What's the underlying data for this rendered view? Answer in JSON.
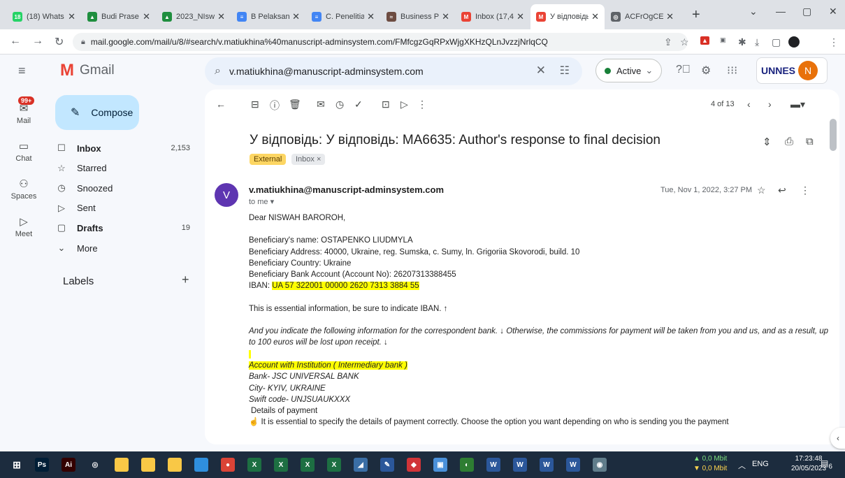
{
  "browser": {
    "tabs": [
      {
        "title": "(18) Whats",
        "fav_color": "#25d366",
        "fav_text": "18"
      },
      {
        "title": "Budi Prase",
        "fav_color": "#1e8e3e",
        "fav_text": "▲"
      },
      {
        "title": "2023_NIsw",
        "fav_color": "#1e8e3e",
        "fav_text": "▲"
      },
      {
        "title": "B Pelaksan",
        "fav_color": "#4285f4",
        "fav_text": "≡"
      },
      {
        "title": "C. Penelitia",
        "fav_color": "#4285f4",
        "fav_text": "≡"
      },
      {
        "title": "Business P",
        "fav_color": "#6d4c41",
        "fav_text": "≈"
      },
      {
        "title": "Inbox (17,4",
        "fav_color": "#ea4335",
        "fav_text": "M"
      },
      {
        "title": "У відповідь",
        "fav_color": "#ea4335",
        "fav_text": "M"
      },
      {
        "title": "ACFrOgCE",
        "fav_color": "#5f6368",
        "fav_text": "◎"
      }
    ],
    "url": "mail.google.com/mail/u/8/#search/v.matiukhina%40manuscript-adminsystem.com/FMfcgzGqRPxWjgXKHzQLnJvzzjNrlqCQ"
  },
  "gmail": {
    "wordmark": "Gmail",
    "search_query": "v.matiukhina@manuscript-adminsystem.com",
    "status": "Active",
    "org_logo": "UNNES",
    "avatar_letter": "N"
  },
  "rail": {
    "mail_badge": "99+",
    "items": [
      "Mail",
      "Chat",
      "Spaces",
      "Meet"
    ]
  },
  "nav": {
    "compose": "Compose",
    "items": [
      {
        "label": "Inbox",
        "count": "2,153",
        "icon": "inbox-icon",
        "glyph": "☐",
        "bold": true
      },
      {
        "label": "Starred",
        "count": "",
        "icon": "star-icon",
        "glyph": "☆",
        "bold": false
      },
      {
        "label": "Snoozed",
        "count": "",
        "icon": "clock-icon",
        "glyph": "◷",
        "bold": false
      },
      {
        "label": "Sent",
        "count": "",
        "icon": "send-icon",
        "glyph": "▷",
        "bold": false
      },
      {
        "label": "Drafts",
        "count": "19",
        "icon": "draft-icon",
        "glyph": "▢",
        "bold": true
      },
      {
        "label": "More",
        "count": "",
        "icon": "chevron-down-icon",
        "glyph": "⌄",
        "bold": false
      }
    ],
    "labels_heading": "Labels"
  },
  "message": {
    "pager": "4 of 13",
    "subject": "У відповідь: У відповідь: MA6635: Author's response to final decision",
    "label_external": "External",
    "label_inbox": "Inbox ×",
    "sender_initial": "V",
    "sender": "v.matiukhina@manuscript-adminsystem.com",
    "to": "to me ▾",
    "date": "Tue, Nov 1, 2022, 3:27 PM",
    "body": {
      "greeting": "Dear NISWAH BAROROH,",
      "beneficiary_name": "Beneficiary's name: OSTAPENKO LIUDMYLA",
      "beneficiary_address": "Beneficiary Address: 40000, Ukraine, reg. Sumska, c. Sumy, ln. Grigoriia Skovorodi, build. 10",
      "beneficiary_country": "Beneficiary Country: Ukraine",
      "beneficiary_account": "Beneficiary Bank Account (Account No): 26207313388455",
      "iban_label": "IBAN: ",
      "iban_value": "UA 57 322001 00000 2620 7313 3884 55",
      "essential": "This is essential information, be sure to indicate IBAN. ↑",
      "correspondent": "And you indicate the following information for the correspondent bank. ↓ Otherwise, the commissions for payment will be taken from you and us, and as a result, up to 100 euros will be lost upon receipt. ↓",
      "institution": "Account with Institution ( Intermediary bank )",
      "bank": "Bank- JSC UNIVERSAL BANK",
      "city": "City- KYIV, UKRAINE",
      "swift": "Swift code- UNJSUAUKXXX",
      "details": "Details of payment",
      "specify": "It is essential to specify the details of payment correctly. Choose the option you want depending on who is sending you the payment"
    }
  },
  "taskbar": {
    "apps": [
      {
        "name": "photoshop",
        "text": "Ps",
        "color": "#001e36"
      },
      {
        "name": "illustrator",
        "text": "Ai",
        "color": "#330000"
      },
      {
        "name": "app-3",
        "text": "◎",
        "color": "#1c2c3e"
      },
      {
        "name": "folder-1",
        "text": "",
        "color": "#f9c846"
      },
      {
        "name": "folder-2",
        "text": "",
        "color": "#f9c846"
      },
      {
        "name": "folder-3",
        "text": "",
        "color": "#f9c846"
      },
      {
        "name": "app-7",
        "text": "",
        "color": "#2f8fdd"
      },
      {
        "name": "chrome",
        "text": "●",
        "color": "#db4437"
      },
      {
        "name": "excel-1",
        "text": "X",
        "color": "#1d6f42"
      },
      {
        "name": "excel-2",
        "text": "X",
        "color": "#1d6f42"
      },
      {
        "name": "excel-3",
        "text": "X",
        "color": "#1d6f42"
      },
      {
        "name": "excel-4",
        "text": "X",
        "color": "#1d6f42"
      },
      {
        "name": "app-13",
        "text": "◢",
        "color": "#3a6ea5"
      },
      {
        "name": "app-14",
        "text": "✎",
        "color": "#2b579a"
      },
      {
        "name": "app-15",
        "text": "◆",
        "color": "#d13438"
      },
      {
        "name": "app-16",
        "text": "▣",
        "color": "#4a90d9"
      },
      {
        "name": "app-17",
        "text": "◐",
        "color": "#2e7d32"
      },
      {
        "name": "word-1",
        "text": "W",
        "color": "#2b579a"
      },
      {
        "name": "word-2",
        "text": "W",
        "color": "#2b579a"
      },
      {
        "name": "word-3",
        "text": "W",
        "color": "#2b579a"
      },
      {
        "name": "word-4",
        "text": "W",
        "color": "#2b579a"
      },
      {
        "name": "app-22",
        "text": "◉",
        "color": "#607d8b"
      }
    ],
    "net_up": "▲ 0,0 Mbit",
    "net_down": "▼ 0,0 Mbit",
    "lang": "ENG",
    "time": "17:23:48",
    "date": "20/05/2023",
    "notif_count": "6"
  }
}
